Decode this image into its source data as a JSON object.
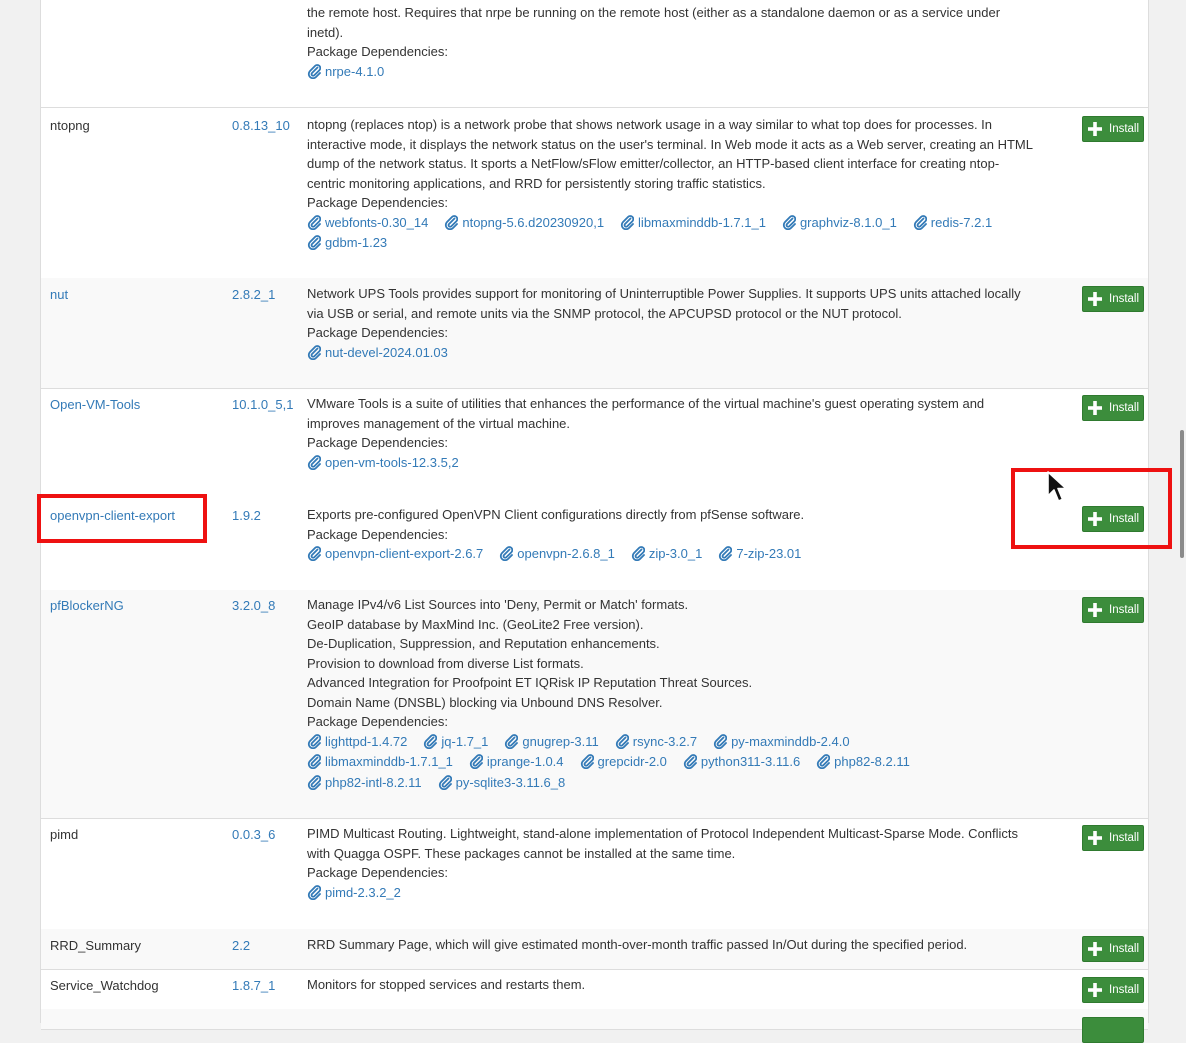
{
  "icons": {
    "attachment": "paperclip-icon",
    "install": "plus-icon",
    "cursor": "mouse-pointer-icon"
  },
  "colors": {
    "link": "#337ab7",
    "install_button": "#3c8d3c",
    "highlight": "#e11111"
  },
  "deps_label": "Package Dependencies:",
  "install_label": "Install",
  "top_fragment": {
    "desc_lines": [
      "the remote host. Requires that nrpe be running on the remote host (either as a standalone daemon or as a service under",
      "inetd)."
    ],
    "deps": [
      "nrpe-4.1.0"
    ]
  },
  "packages": [
    {
      "name": "ntopng",
      "version": "0.8.13_10",
      "desc_lines": [
        "ntopng (replaces ntop) is a network probe that shows network usage in a way similar to what top does for processes. In",
        "interactive mode, it displays the network status on the user's terminal. In Web mode it acts as a Web server, creating an HTML",
        "dump of the network status. It sports a NetFlow/sFlow emitter/collector, an HTTP-based client interface for creating ntop-",
        "centric monitoring applications, and RRD for persistently storing traffic statistics."
      ],
      "deps": [
        "webfonts-0.30_14",
        "ntopng-5.6.d20230920,1",
        "libmaxminddb-1.7.1_1",
        "graphviz-8.1.0_1",
        "redis-7.2.1",
        "gdbm-1.23"
      ]
    },
    {
      "name": "nut",
      "version": "2.8.2_1",
      "desc_lines": [
        "Network UPS Tools provides support for monitoring of Uninterruptible Power Supplies. It supports UPS units attached locally",
        "via USB or serial, and remote units via the SNMP protocol, the APCUPSD protocol or the NUT protocol."
      ],
      "deps": [
        "nut-devel-2024.01.03"
      ]
    },
    {
      "name": "Open-VM-Tools",
      "version": "10.1.0_5,1",
      "desc_lines": [
        "VMware Tools is a suite of utilities that enhances the performance of the virtual machine's guest operating system and",
        "improves management of the virtual machine."
      ],
      "deps": [
        "open-vm-tools-12.3.5,2"
      ]
    },
    {
      "name": "openvpn-client-export",
      "version": "1.9.2",
      "desc_lines": [
        "Exports pre-configured OpenVPN Client configurations directly from pfSense software."
      ],
      "deps": [
        "openvpn-client-export-2.6.7",
        "openvpn-2.6.8_1",
        "zip-3.0_1",
        "7-zip-23.01"
      ]
    },
    {
      "name": "pfBlockerNG",
      "version": "3.2.0_8",
      "desc_lines": [
        "Manage IPv4/v6 List Sources into 'Deny, Permit or Match' formats.",
        "GeoIP database by MaxMind Inc. (GeoLite2 Free version).",
        "De-Duplication, Suppression, and Reputation enhancements.",
        "Provision to download from diverse List formats.",
        "Advanced Integration for Proofpoint ET IQRisk IP Reputation Threat Sources.",
        "Domain Name (DNSBL) blocking via Unbound DNS Resolver."
      ],
      "deps": [
        "lighttpd-1.4.72",
        "jq-1.7_1",
        "gnugrep-3.11",
        "rsync-3.2.7",
        "py-maxminddb-2.4.0",
        "libmaxminddb-1.7.1_1",
        "iprange-1.0.4",
        "grepcidr-2.0",
        "python311-3.11.6",
        "php82-8.2.11",
        "php82-intl-8.2.11",
        "py-sqlite3-3.11.6_8"
      ]
    },
    {
      "name": "pimd",
      "version": "0.0.3_6",
      "desc_lines": [
        "PIMD Multicast Routing. Lightweight, stand-alone implementation of Protocol Independent Multicast-Sparse Mode. Conflicts",
        "with Quagga OSPF. These packages cannot be installed at the same time."
      ],
      "deps": [
        "pimd-2.3.2_2"
      ]
    },
    {
      "name": "RRD_Summary",
      "version": "2.2",
      "desc_lines": [
        "RRD Summary Page, which will give estimated month-over-month traffic passed In/Out during the specified period."
      ],
      "deps": []
    },
    {
      "name": "Service_Watchdog",
      "version": "1.8.7_1",
      "desc_lines": [
        "Monitors for stopped services and restarts them."
      ],
      "deps": []
    }
  ]
}
